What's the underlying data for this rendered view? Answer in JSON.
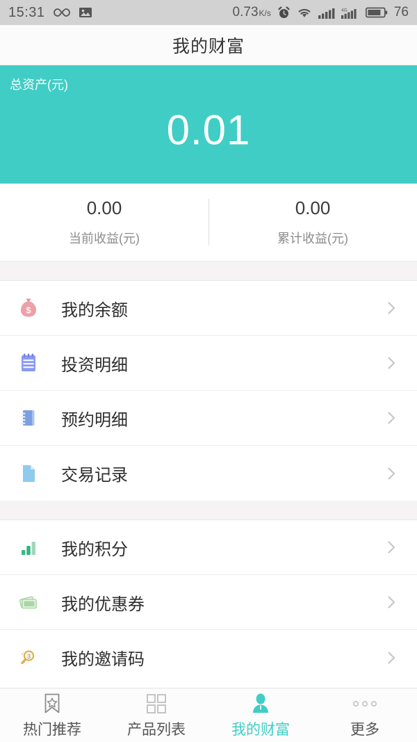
{
  "theme": {
    "teal": "#40cdc5",
    "page_bg": "#f5f3f3",
    "text_primary": "#2e2e2e",
    "text_muted": "#8d8d8d"
  },
  "statusbar": {
    "time": "15:31",
    "infinity_icon": "infinity-icon",
    "photo_icon": "image-icon",
    "network_speed": "0.73",
    "network_speed_unit": "K/s",
    "alarm_icon": "alarm-clock-icon",
    "wifi_icon": "wifi-icon",
    "signal_icon": "signal-bars-icon",
    "signal_4g_icon": "signal-4g-icon",
    "signal_4g_label": "4G",
    "battery_icon": "battery-icon",
    "battery_level": "76"
  },
  "header": {
    "title": "我的财富"
  },
  "total_card": {
    "label": "总资产(元)",
    "amount": "0.01"
  },
  "earnings": [
    {
      "value": "0.00",
      "label": "当前收益(元)"
    },
    {
      "value": "0.00",
      "label": "累计收益(元)"
    }
  ],
  "menu_groups": [
    {
      "items": [
        {
          "label": "我的余额",
          "icon": "money-bag-icon"
        },
        {
          "label": "投资明细",
          "icon": "notepad-icon"
        },
        {
          "label": "预约明细",
          "icon": "spiral-notebook-icon"
        },
        {
          "label": "交易记录",
          "icon": "document-icon"
        }
      ]
    },
    {
      "items": [
        {
          "label": "我的积分",
          "icon": "bar-chart-icon"
        },
        {
          "label": "我的优惠券",
          "icon": "coupon-icon"
        },
        {
          "label": "我的邀请码",
          "icon": "magnifier-icon"
        }
      ]
    }
  ],
  "chevron_icon": "chevron-right-icon",
  "bottom_nav": [
    {
      "label": "热门推荐",
      "icon": "bookmark-star-icon",
      "active": false
    },
    {
      "label": "产品列表",
      "icon": "grid-squares-icon",
      "active": false
    },
    {
      "label": "我的财富",
      "icon": "person-icon",
      "active": true
    },
    {
      "label": "更多",
      "icon": "more-dots-icon",
      "active": false
    }
  ]
}
